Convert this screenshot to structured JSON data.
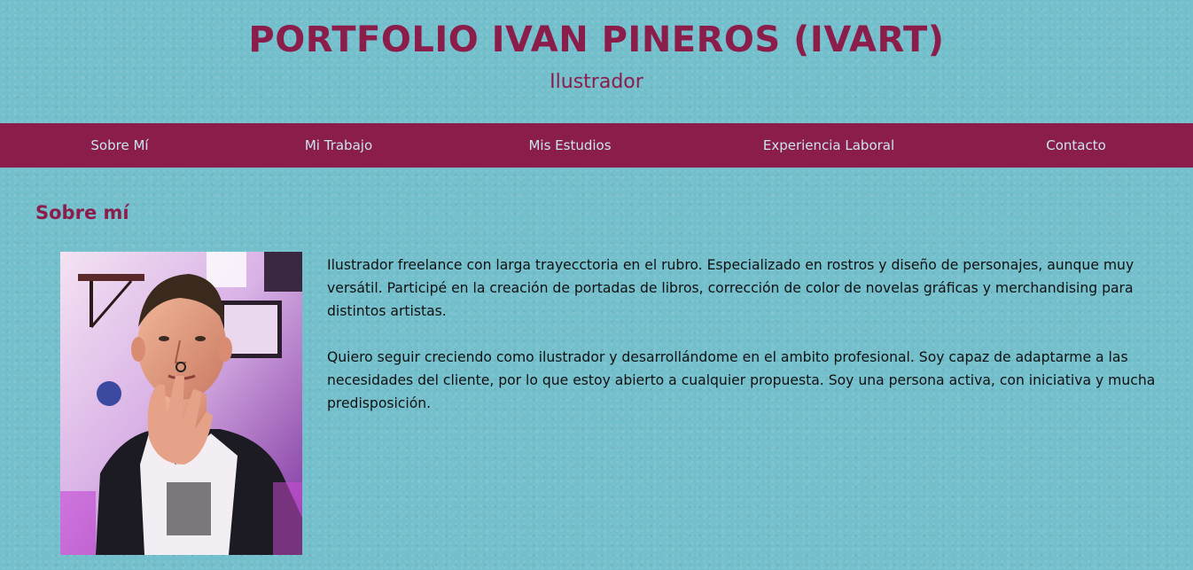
{
  "header": {
    "title": "PORTFOLIO IVAN PINEROS (IVART)",
    "subtitle": "Ilustrador"
  },
  "nav": {
    "items": [
      {
        "label": "Sobre Mí"
      },
      {
        "label": "Mi Trabajo"
      },
      {
        "label": "Mis Estudios"
      },
      {
        "label": "Experiencia Laboral"
      },
      {
        "label": "Contacto"
      }
    ]
  },
  "about": {
    "title": "Sobre mí",
    "paragraphs": [
      "Ilustrador freelance con larga trayecctoria en el rubro. Especializado en rostros y diseño de personajes, aunque muy versátil. Participé en la creación de portadas de libros, corrección de color de novelas gráficas y merchandising para distintos artistas.",
      "Quiero seguir creciendo como ilustrador y desarrollándome en el ambito profesional. Soy capaz de adaptarme a las necesidades del cliente, por lo que estoy abierto a cualquier propuesta. Soy una persona activa, con iniciativa y mucha predisposición."
    ]
  },
  "colors": {
    "background": "#74bfcc",
    "accent": "#8b1d4b",
    "nav_text": "#c9e6ee"
  }
}
